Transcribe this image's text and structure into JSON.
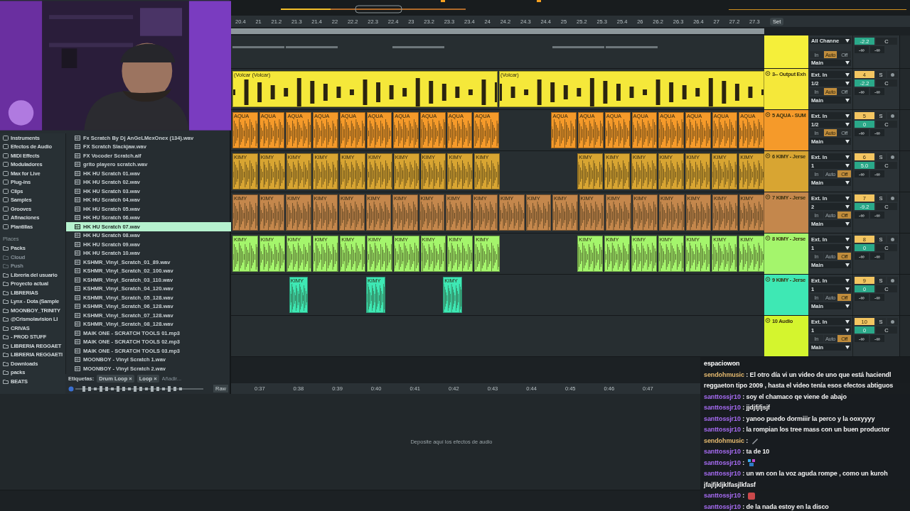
{
  "browser": {
    "categories": [
      {
        "label": "Instruments"
      },
      {
        "label": "Efectos de Audio"
      },
      {
        "label": "MIDI Effects"
      },
      {
        "label": "Moduladores"
      },
      {
        "label": "Max for Live"
      },
      {
        "label": "Plug-ins"
      },
      {
        "label": "Clips"
      },
      {
        "label": "Samples"
      },
      {
        "label": "Grooves"
      },
      {
        "label": "Afinaciones"
      },
      {
        "label": "Plantillas"
      }
    ],
    "places_title": "Places",
    "places": [
      {
        "label": "Packs",
        "disabled": false
      },
      {
        "label": "Cloud",
        "disabled": true
      },
      {
        "label": "Push",
        "disabled": true
      },
      {
        "label": "Libreria del usuario",
        "disabled": false
      },
      {
        "label": "Proyecto actual",
        "disabled": false
      },
      {
        "label": "LIBRERIAS",
        "disabled": false
      },
      {
        "label": "Lynx - Dota (Sample",
        "disabled": false
      },
      {
        "label": "MOONBOY_TRINITY",
        "disabled": false
      },
      {
        "label": "@Crismolavision LI",
        "disabled": false
      },
      {
        "label": "CRIVAS",
        "disabled": false
      },
      {
        "label": "- PROD STUFF",
        "disabled": false
      },
      {
        "label": "LIBRERIA REGGAET",
        "disabled": false
      },
      {
        "label": "LIBRERIA REGGAETI",
        "disabled": false
      },
      {
        "label": "Downloads",
        "disabled": false
      },
      {
        "label": "packs",
        "disabled": false
      },
      {
        "label": "BEATS",
        "disabled": false
      }
    ],
    "files": [
      {
        "name": "Fx Scratch By Dj AnGeLMexOnex (134).wav",
        "selected": false
      },
      {
        "name": "FX Scratch Slackjaw.wav",
        "selected": false
      },
      {
        "name": "FX Vocoder Scratch.aif",
        "selected": false
      },
      {
        "name": "grito playero scratch.wav",
        "selected": false
      },
      {
        "name": "HK HU Scratch 01.wav",
        "selected": false
      },
      {
        "name": "HK HU Scratch 02.wav",
        "selected": false
      },
      {
        "name": "HK HU Scratch 03.wav",
        "selected": false
      },
      {
        "name": "HK HU Scratch 04.wav",
        "selected": false
      },
      {
        "name": "HK HU Scratch 05.wav",
        "selected": false
      },
      {
        "name": "HK HU Scratch 06.wav",
        "selected": false
      },
      {
        "name": "HK HU Scratch 07.wav",
        "selected": true
      },
      {
        "name": "HK HU Scratch 08.wav",
        "selected": false
      },
      {
        "name": "HK HU Scratch 09.wav",
        "selected": false
      },
      {
        "name": "HK HU Scratch 10.wav",
        "selected": false
      },
      {
        "name": "KSHMR_Vinyl_Scratch_01_89.wav",
        "selected": false
      },
      {
        "name": "KSHMR_Vinyl_Scratch_02_100.wav",
        "selected": false
      },
      {
        "name": "KSHMR_Vinyl_Scratch_03_110.wav",
        "selected": false
      },
      {
        "name": "KSHMR_Vinyl_Scratch_04_120.wav",
        "selected": false
      },
      {
        "name": "KSHMR_Vinyl_Scratch_05_128.wav",
        "selected": false
      },
      {
        "name": "KSHMR_Vinyl_Scratch_06_128.wav",
        "selected": false
      },
      {
        "name": "KSHMR_Vinyl_Scratch_07_128.wav",
        "selected": false
      },
      {
        "name": "KSHMR_Vinyl_Scratch_08_128.wav",
        "selected": false
      },
      {
        "name": "MAIK ONE - SCRATCH TOOLS 01.mp3",
        "selected": false
      },
      {
        "name": "MAIK ONE - SCRATCH TOOLS 02.mp3",
        "selected": false
      },
      {
        "name": "MAIK ONE - SCRATCH TOOLS 03.mp3",
        "selected": false
      },
      {
        "name": "MOONBOY - Vinyl Scratch 1.wav",
        "selected": false
      },
      {
        "name": "MOONBOY - Vinyl Scratch 2.wav",
        "selected": false
      }
    ],
    "tags_label": "Etiquetas:",
    "tags": [
      {
        "label": "Drum Loop",
        "remove": "×"
      },
      {
        "label": "Loop",
        "remove": "×"
      }
    ],
    "tag_placeholder": "Añadir...",
    "raw_button": "Raw"
  },
  "arrangement": {
    "ruler": [
      "20.4",
      "21",
      "21.2",
      "21.3",
      "21.4",
      "22",
      "22.2",
      "22.3",
      "22.4",
      "23",
      "23.2",
      "23.3",
      "23.4",
      "24",
      "24.2",
      "24.3",
      "24.4",
      "25",
      "25.2",
      "25.3",
      "25.4",
      "26",
      "26.2",
      "26.3",
      "26.4",
      "27",
      "27.2",
      "27.3"
    ],
    "set_button": "Set",
    "tracks": [
      {
        "color": "#f5ef3a",
        "input": "All Channe",
        "monitor": [
          {
            "label": "In",
            "selected": false
          },
          {
            "label": "Auto",
            "selected": true
          },
          {
            "label": "Off",
            "selected": false
          }
        ],
        "output": "Main",
        "volume": "-2.2",
        "pan": "C",
        "peak_left": "-∞",
        "peak_right": "-∞",
        "clips": [
          {
            "kind": "stub"
          },
          {
            "kind": "stub"
          },
          {
            "kind": "gap"
          },
          {
            "kind": "stub"
          },
          {
            "kind": "gap"
          },
          {
            "kind": "gap"
          },
          {
            "kind": "stub"
          },
          {
            "kind": "stub"
          },
          {
            "kind": "gap"
          },
          {
            "kind": "gap"
          }
        ]
      },
      {
        "name": "3-- Output Exh",
        "color": "#f5e83a",
        "input": "Ext. In",
        "channel": "1/2",
        "monitor": [
          {
            "label": "In",
            "selected": false
          },
          {
            "label": "Auto",
            "selected": true
          },
          {
            "label": "Off",
            "selected": false
          }
        ],
        "output": "Main",
        "number": "4",
        "solo": "S",
        "volume": "-2.2",
        "pan": "C",
        "peak_left": "-∞",
        "peak_right": "-∞",
        "clips": [
          {
            "kind": "clip",
            "label": "(Volcar (Volcar)"
          },
          {
            "kind": "clip",
            "label": "(Volcar)"
          }
        ]
      },
      {
        "name": "5 AQUA - SUM",
        "color": "#f59a2a",
        "input": "Ext. In",
        "channel": "1/2",
        "monitor": [
          {
            "label": "In",
            "selected": false
          },
          {
            "label": "Auto",
            "selected": true
          },
          {
            "label": "Off",
            "selected": false
          }
        ],
        "output": "Main",
        "number": "5",
        "solo": "S",
        "volume": "0",
        "pan": "C",
        "peak_left": "-∞",
        "peak_right": "-∞",
        "clips": [
          {
            "kind": "clip",
            "label": "AQUA"
          },
          {
            "kind": "clip",
            "label": "AQUA"
          },
          {
            "kind": "clip",
            "label": "AQUA"
          },
          {
            "kind": "clip",
            "label": "AQUA"
          },
          {
            "kind": "clip",
            "label": "AQUA"
          },
          {
            "kind": "clip",
            "label": "AQUA"
          },
          {
            "kind": "clip",
            "label": "AQUA"
          },
          {
            "kind": "clip",
            "label": "AQUA"
          },
          {
            "kind": "clip",
            "label": "AQUA"
          },
          {
            "kind": "clip",
            "label": "AQUA"
          },
          {
            "kind": "gap"
          },
          {
            "kind": "gap"
          },
          {
            "kind": "clip",
            "label": "AQUA"
          },
          {
            "kind": "clip",
            "label": "AQUA"
          },
          {
            "kind": "clip",
            "label": "AQUA"
          },
          {
            "kind": "clip",
            "label": "AQUA"
          },
          {
            "kind": "clip",
            "label": "AQUA"
          },
          {
            "kind": "clip",
            "label": "AQUA"
          },
          {
            "kind": "clip",
            "label": "AQUA"
          },
          {
            "kind": "clip",
            "label": "AQUA"
          }
        ]
      },
      {
        "name": "6 KIMY - Jerse",
        "color": "#d8a532",
        "input": "Ext. In",
        "channel": "1",
        "monitor": [
          {
            "label": "In",
            "selected": false
          },
          {
            "label": "Auto",
            "selected": false
          },
          {
            "label": "Off",
            "selected": true
          }
        ],
        "output": "Main",
        "number": "6",
        "solo": "S",
        "volume": "5.0",
        "pan": "C",
        "peak_left": "-∞",
        "peak_right": "-∞",
        "clips": [
          {
            "kind": "clip",
            "label": "KIMY"
          },
          {
            "kind": "clip",
            "label": "KIMY"
          },
          {
            "kind": "clip",
            "label": "KIMY"
          },
          {
            "kind": "clip",
            "label": "KIMY"
          },
          {
            "kind": "clip",
            "label": "KIMY"
          },
          {
            "kind": "clip",
            "label": "KIMY"
          },
          {
            "kind": "clip",
            "label": "KIMY"
          },
          {
            "kind": "clip",
            "label": "KIMY"
          },
          {
            "kind": "clip",
            "label": "KIMY"
          },
          {
            "kind": "clip",
            "label": "KIMY"
          },
          {
            "kind": "gap"
          },
          {
            "kind": "gap"
          },
          {
            "kind": "gap"
          },
          {
            "kind": "clip",
            "label": "KIMY"
          },
          {
            "kind": "clip",
            "label": "KIMY"
          },
          {
            "kind": "clip",
            "label": "KIMY"
          },
          {
            "kind": "clip",
            "label": "KIMY"
          },
          {
            "kind": "clip",
            "label": "KIMY"
          },
          {
            "kind": "clip",
            "label": "KIMY"
          },
          {
            "kind": "clip",
            "label": "KIMY"
          }
        ]
      },
      {
        "name": "7 KIMY - Jerse",
        "color": "#c4874c",
        "input": "Ext. In",
        "channel": "2",
        "monitor": [
          {
            "label": "In",
            "selected": false
          },
          {
            "label": "Auto",
            "selected": false
          },
          {
            "label": "Off",
            "selected": true
          }
        ],
        "output": "Main",
        "number": "7",
        "solo": "S",
        "volume": "-9.2",
        "pan": "C",
        "peak_left": "-∞",
        "peak_right": "-∞",
        "clips": [
          {
            "kind": "clip",
            "label": "KIMY"
          },
          {
            "kind": "clip",
            "label": "KIMY"
          },
          {
            "kind": "clip",
            "label": "KIMY"
          },
          {
            "kind": "clip",
            "label": "KIMY"
          },
          {
            "kind": "clip",
            "label": "KIMY"
          },
          {
            "kind": "clip",
            "label": "KIMY"
          },
          {
            "kind": "clip",
            "label": "KIMY"
          },
          {
            "kind": "clip",
            "label": "KIMY"
          },
          {
            "kind": "clip",
            "label": "KIMY"
          },
          {
            "kind": "clip",
            "label": "KIMY"
          },
          {
            "kind": "clip",
            "label": "KIMY"
          },
          {
            "kind": "clip",
            "label": "KIMY"
          },
          {
            "kind": "clip",
            "label": "KIMY"
          },
          {
            "kind": "clip",
            "label": "KIMY"
          },
          {
            "kind": "clip",
            "label": "KIMY"
          },
          {
            "kind": "clip",
            "label": "KIMY"
          },
          {
            "kind": "clip",
            "label": "KIMY"
          },
          {
            "kind": "clip",
            "label": "KIMY"
          },
          {
            "kind": "clip",
            "label": "KIMY"
          },
          {
            "kind": "clip",
            "label": "KIMY"
          }
        ]
      },
      {
        "name": "8 KIMY - Jerse",
        "color": "#a4f56c",
        "input": "Ext. In",
        "channel": "1",
        "monitor": [
          {
            "label": "In",
            "selected": false
          },
          {
            "label": "Auto",
            "selected": false
          },
          {
            "label": "Off",
            "selected": true
          }
        ],
        "output": "Main",
        "number": "8",
        "solo": "S",
        "volume": "0",
        "pan": "C",
        "peak_left": "-∞",
        "peak_right": "-∞",
        "clips": [
          {
            "kind": "clip",
            "label": "KIMY"
          },
          {
            "kind": "clip",
            "label": "KIMY"
          },
          {
            "kind": "clip",
            "label": "KIMY"
          },
          {
            "kind": "clip",
            "label": "KIMY"
          },
          {
            "kind": "clip",
            "label": "KIMY"
          },
          {
            "kind": "clip",
            "label": "KIMY"
          },
          {
            "kind": "clip",
            "label": "KIMY"
          },
          {
            "kind": "clip",
            "label": "KIMY"
          },
          {
            "kind": "clip",
            "label": "KIMY"
          },
          {
            "kind": "clip",
            "label": "KIMY"
          },
          {
            "kind": "gap"
          },
          {
            "kind": "gap"
          },
          {
            "kind": "gap"
          },
          {
            "kind": "clip",
            "label": "KIMY"
          },
          {
            "kind": "clip",
            "label": "KIMY"
          },
          {
            "kind": "clip",
            "label": "KIMY"
          },
          {
            "kind": "clip",
            "label": "KIMY"
          },
          {
            "kind": "clip",
            "label": "KIMY"
          },
          {
            "kind": "clip",
            "label": "KIMY"
          },
          {
            "kind": "clip",
            "label": "KIMY"
          }
        ]
      },
      {
        "name": "9 KIMY - Jerse",
        "color": "#3ee8b4",
        "input": "Ext. In",
        "channel": "1",
        "monitor": [
          {
            "label": "In",
            "selected": false
          },
          {
            "label": "Auto",
            "selected": false
          },
          {
            "label": "Off",
            "selected": true
          }
        ],
        "output": "Main",
        "number": "9",
        "solo": "S",
        "volume": "0",
        "pan": "C",
        "peak_left": "-∞",
        "peak_right": "-∞",
        "clips": [
          {
            "kind": "gap"
          },
          {
            "kind": "gap"
          },
          {
            "kind": "gap"
          },
          {
            "kind": "clip",
            "label": "KIMY"
          },
          {
            "kind": "gap"
          },
          {
            "kind": "gap"
          },
          {
            "kind": "gap"
          },
          {
            "kind": "clip",
            "label": "KIMY"
          },
          {
            "kind": "gap"
          },
          {
            "kind": "gap"
          },
          {
            "kind": "gap"
          },
          {
            "kind": "clip",
            "label": "KIMY"
          },
          {
            "kind": "gap"
          },
          {
            "kind": "gap"
          },
          {
            "kind": "gap"
          },
          {
            "kind": "gap"
          },
          {
            "kind": "gap"
          },
          {
            "kind": "gap"
          },
          {
            "kind": "gap"
          },
          {
            "kind": "gap"
          },
          {
            "kind": "gap"
          },
          {
            "kind": "gap"
          },
          {
            "kind": "gap"
          },
          {
            "kind": "gap"
          },
          {
            "kind": "gap"
          },
          {
            "kind": "gap"
          },
          {
            "kind": "gap"
          },
          {
            "kind": "gap"
          }
        ]
      },
      {
        "name": "10 Audio",
        "color": "#d4f52e",
        "input": "Ext. In",
        "channel": "1",
        "monitor": [
          {
            "label": "In",
            "selected": false
          },
          {
            "label": "Auto",
            "selected": false
          },
          {
            "label": "Off",
            "selected": true
          }
        ],
        "output": "Main",
        "number": "10",
        "solo": "S",
        "volume": "0",
        "pan": "C",
        "peak_left": "-∞",
        "peak_right": "-∞"
      }
    ],
    "time_ruler": [
      "0:37",
      "0:38",
      "0:39",
      "0:40",
      "0:41",
      "0:42",
      "0:43",
      "0:44",
      "0:45",
      "0:46",
      "0:47"
    ],
    "drop_hint": "Deposite aquí los efectos de audio"
  },
  "chat": [
    {
      "kind": "name",
      "user": "espaciowon",
      "color": "#ffffff"
    },
    {
      "kind": "text",
      "user": "sendohmusic",
      "color": "#e3b86e",
      "text": " : El otro día vi un video de uno que está haciendl reggaeton tipo 2009 , hasta el video tenía esos efectos abtiguos"
    },
    {
      "kind": "text",
      "user": "santtossjr10",
      "color": "#a66bf2",
      "text": " : soy el chamaco qe viene de abajo"
    },
    {
      "kind": "text",
      "user": "santtossjr10",
      "color": "#a66bf2",
      "text": " : jjdjfjfjsjf"
    },
    {
      "kind": "text",
      "user": "santtossjr10",
      "color": "#a66bf2",
      "text": " : yanoo puedo dormiiir la perco y la ooxyyyy"
    },
    {
      "kind": "text",
      "user": "santtossjr10",
      "color": "#a66bf2",
      "text": " : la rompian los tree mass con un buen productor"
    },
    {
      "kind": "emote",
      "user": "sendohmusic",
      "color": "#e3b86e",
      "text": " :",
      "emote": {
        "kind": "knife"
      }
    },
    {
      "kind": "text",
      "user": "santtossjr10",
      "color": "#a66bf2",
      "text": " : ta de 10"
    },
    {
      "kind": "emote",
      "user": "santtossjr10",
      "color": "#a66bf2",
      "text": " :",
      "emote": {
        "kind": "pixel"
      }
    },
    {
      "kind": "text",
      "user": "santtossjr10",
      "color": "#a66bf2",
      "text": " : un wn con la voz aguda rompe , como un kuroh jfajfjkljklfasjlkfasf"
    },
    {
      "kind": "emote",
      "user": "santtossjr10",
      "color": "#a66bf2",
      "text": " :",
      "emote": {
        "kind": "face"
      }
    },
    {
      "kind": "text",
      "user": "santtossjr10",
      "color": "#a66bf2",
      "text": " : de la nada estoy en la disco"
    }
  ]
}
